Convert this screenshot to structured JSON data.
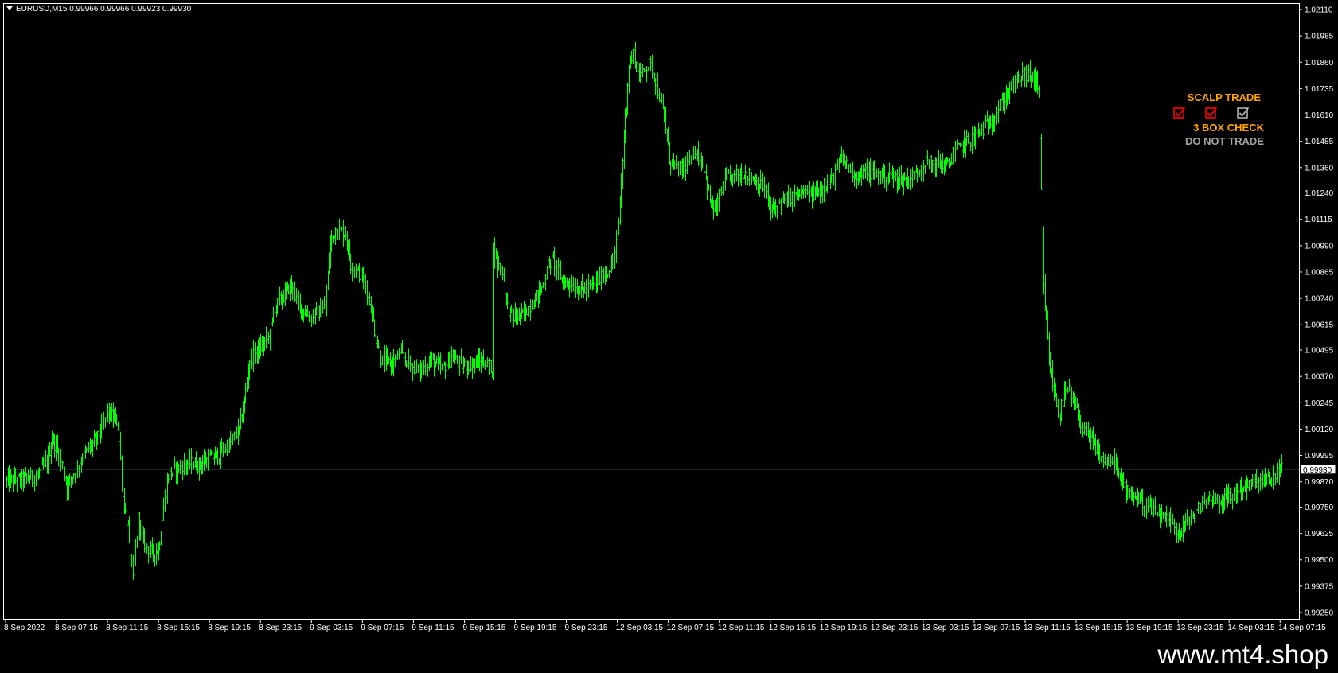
{
  "symbol_header": "EURUSD,M15  0.99966 0.99966 0.99923 0.99930",
  "indicator": {
    "title": "SCALP TRADE",
    "checks": [
      {
        "state": "checked",
        "color": "#ff0000"
      },
      {
        "state": "checked",
        "color": "#ff0000"
      },
      {
        "state": "checked",
        "color": "#b0b0b0"
      }
    ],
    "label_main": "3 BOX CHECK",
    "label_status": "DO NOT TRADE",
    "colors": {
      "title": "#ffa500",
      "status": "#a0a0a0"
    }
  },
  "footer_url": "www.mt4.shop",
  "chart_data": {
    "type": "candlestick",
    "symbol": "EURUSD",
    "timeframe": "M15",
    "current_price": 0.9993,
    "current_price_label": "0.99930",
    "ylim": [
      0.9925,
      1.0211
    ],
    "y_ticks": [
      "1.02110",
      "1.01985",
      "1.01860",
      "1.01735",
      "1.01610",
      "1.01485",
      "1.01360",
      "1.01240",
      "1.01115",
      "1.00990",
      "1.00865",
      "1.00740",
      "1.00615",
      "1.00495",
      "1.00370",
      "1.00245",
      "1.00120",
      "0.99995",
      "0.99870",
      "0.99750",
      "0.99625",
      "0.99500",
      "0.99375",
      "0.99250"
    ],
    "x_ticks": [
      "8 Sep 2022",
      "8 Sep 07:15",
      "8 Sep 11:15",
      "8 Sep 15:15",
      "8 Sep 19:15",
      "8 Sep 23:15",
      "9 Sep 03:15",
      "9 Sep 07:15",
      "9 Sep 11:15",
      "9 Sep 15:15",
      "9 Sep 19:15",
      "9 Sep 23:15",
      "12 Sep 03:15",
      "12 Sep 07:15",
      "12 Sep 11:15",
      "12 Sep 15:15",
      "12 Sep 19:15",
      "12 Sep 23:15",
      "13 Sep 03:15",
      "13 Sep 07:15",
      "13 Sep 11:15",
      "13 Sep 15:15",
      "13 Sep 19:15",
      "13 Sep 23:15",
      "14 Sep 03:15",
      "14 Sep 07:15"
    ],
    "close_path": [
      [
        0,
        0.99875
      ],
      [
        3,
        0.9988
      ],
      [
        6,
        0.999
      ],
      [
        8,
        0.9996
      ],
      [
        9,
        1.0008
      ],
      [
        11,
        0.9995
      ],
      [
        12,
        0.9985
      ],
      [
        14,
        0.9995
      ],
      [
        16,
        1.0002
      ],
      [
        18,
        1.0008
      ],
      [
        20,
        1.002
      ],
      [
        22,
        1.0015
      ],
      [
        23,
        0.998
      ],
      [
        24,
        0.9965
      ],
      [
        25,
        0.994
      ],
      [
        26,
        0.997
      ],
      [
        27,
        0.9958
      ],
      [
        29,
        0.9953
      ],
      [
        30,
        0.9955
      ],
      [
        31,
        0.9975
      ],
      [
        32,
        0.999
      ],
      [
        34,
        0.9994
      ],
      [
        36,
        0.9996
      ],
      [
        38,
        0.9995
      ],
      [
        40,
        0.9998
      ],
      [
        42,
        1.0
      ],
      [
        44,
        1.0005
      ],
      [
        46,
        1.0012
      ],
      [
        47,
        1.0025
      ],
      [
        48,
        1.0045
      ],
      [
        50,
        1.005
      ],
      [
        52,
        1.0056
      ],
      [
        53,
        1.007
      ],
      [
        55,
        1.0076
      ],
      [
        56,
        1.008
      ],
      [
        58,
        1.007
      ],
      [
        60,
        1.0065
      ],
      [
        62,
        1.0068
      ],
      [
        63,
        1.007
      ],
      [
        64,
        1.01
      ],
      [
        65,
        1.0107
      ],
      [
        67,
        1.0105
      ],
      [
        68,
        1.009
      ],
      [
        70,
        1.0085
      ],
      [
        71,
        1.008
      ],
      [
        72,
        1.007
      ],
      [
        73,
        1.0055
      ],
      [
        74,
        1.0045
      ],
      [
        76,
        1.0043
      ],
      [
        78,
        1.0047
      ],
      [
        80,
        1.0042
      ],
      [
        82,
        1.004
      ],
      [
        84,
        1.0045
      ],
      [
        86,
        1.004
      ],
      [
        88,
        1.0046
      ],
      [
        90,
        1.0042
      ],
      [
        92,
        1.0043
      ],
      [
        94,
        1.0044
      ],
      [
        96,
        1.0041
      ],
      [
        96.1,
        1.01
      ],
      [
        97,
        1.009
      ],
      [
        98,
        1.0087
      ],
      [
        99,
        1.007
      ],
      [
        100,
        1.0065
      ],
      [
        102,
        1.0066
      ],
      [
        104,
        1.0072
      ],
      [
        106,
        1.008
      ],
      [
        107,
        1.009
      ],
      [
        108,
        1.0092
      ],
      [
        110,
        1.0082
      ],
      [
        112,
        1.008
      ],
      [
        114,
        1.0078
      ],
      [
        116,
        1.008
      ],
      [
        118,
        1.0085
      ],
      [
        120,
        1.009
      ],
      [
        121,
        1.011
      ],
      [
        122,
        1.015
      ],
      [
        123,
        1.0185
      ],
      [
        124,
        1.019
      ],
      [
        125,
        1.018
      ],
      [
        127,
        1.0185
      ],
      [
        128,
        1.018
      ],
      [
        129,
        1.017
      ],
      [
        130,
        1.016
      ],
      [
        131,
        1.014
      ],
      [
        133,
        1.0135
      ],
      [
        135,
        1.0138
      ],
      [
        136,
        1.0145
      ],
      [
        137,
        1.014
      ],
      [
        138,
        1.0135
      ],
      [
        139,
        1.012
      ],
      [
        140,
        1.0115
      ],
      [
        142,
        1.013
      ],
      [
        144,
        1.0132
      ],
      [
        146,
        1.0134
      ],
      [
        148,
        1.013
      ],
      [
        150,
        1.0125
      ],
      [
        151,
        1.0115
      ],
      [
        153,
        1.012
      ],
      [
        155,
        1.0122
      ],
      [
        157,
        1.0124
      ],
      [
        159,
        1.0123
      ],
      [
        161,
        1.0126
      ],
      [
        163,
        1.013
      ],
      [
        164,
        1.0135
      ],
      [
        165,
        1.014
      ],
      [
        166,
        1.0138
      ],
      [
        168,
        1.0132
      ],
      [
        170,
        1.0134
      ],
      [
        172,
        1.0133
      ],
      [
        174,
        1.0132
      ],
      [
        176,
        1.0131
      ],
      [
        178,
        1.013
      ],
      [
        180,
        1.0134
      ],
      [
        182,
        1.0139
      ],
      [
        184,
        1.0138
      ],
      [
        186,
        1.0137
      ],
      [
        187,
        1.0142
      ],
      [
        189,
        1.0147
      ],
      [
        191,
        1.015
      ],
      [
        193,
        1.0154
      ],
      [
        175.1,
        1.0132
      ],
      [
        195,
        1.016
      ],
      [
        197,
        1.0168
      ],
      [
        199,
        1.0176
      ],
      [
        201,
        1.018
      ],
      [
        203,
        1.0179
      ],
      [
        204,
        1.017
      ],
      [
        205,
        1.008
      ],
      [
        206,
        1.0045
      ],
      [
        207,
        1.003
      ],
      [
        208,
        1.0018
      ],
      [
        209,
        1.0028
      ],
      [
        210,
        1.003
      ],
      [
        211,
        1.0023
      ],
      [
        212,
        1.0017
      ],
      [
        213,
        1.001
      ],
      [
        215,
        1.0005
      ],
      [
        216,
        0.9999
      ],
      [
        218,
        0.9995
      ],
      [
        219,
        0.9998
      ],
      [
        220,
        0.9987
      ],
      [
        221,
        0.9985
      ],
      [
        223,
        0.998
      ],
      [
        225,
        0.9976
      ],
      [
        227,
        0.9972
      ],
      [
        229,
        0.9969
      ],
      [
        231,
        0.9965
      ],
      [
        232,
        0.9962
      ],
      [
        233,
        0.9968
      ],
      [
        235,
        0.9972
      ],
      [
        236,
        0.9976
      ],
      [
        238,
        0.998
      ],
      [
        240,
        0.9978
      ],
      [
        242,
        0.998
      ],
      [
        244,
        0.9984
      ],
      [
        246,
        0.9986
      ],
      [
        248,
        0.9987
      ],
      [
        250,
        0.9988
      ],
      [
        251,
        0.9992
      ],
      [
        252,
        0.9993
      ]
    ]
  }
}
